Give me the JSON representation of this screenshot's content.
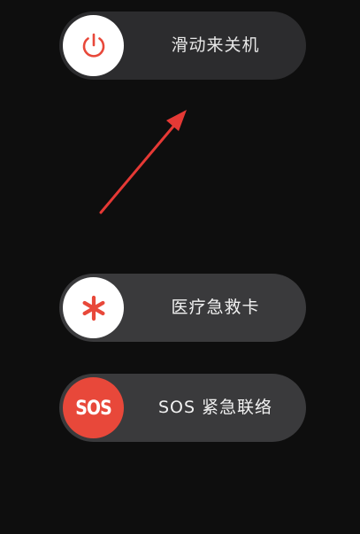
{
  "power_slider": {
    "label": "滑动来关机",
    "icon": "power-icon"
  },
  "medical_id_slider": {
    "label": "医疗急救卡",
    "icon": "asterisk-icon"
  },
  "sos_slider": {
    "label": "SOS 紧急联络",
    "knob_text": "SOS"
  },
  "colors": {
    "background": "#0e0e0e",
    "slider_track": "#3a3a3c",
    "power_track": "#2c2c2e",
    "accent_red": "#e8483a",
    "knob_white": "#ffffff",
    "annotation_arrow": "#e53935"
  }
}
